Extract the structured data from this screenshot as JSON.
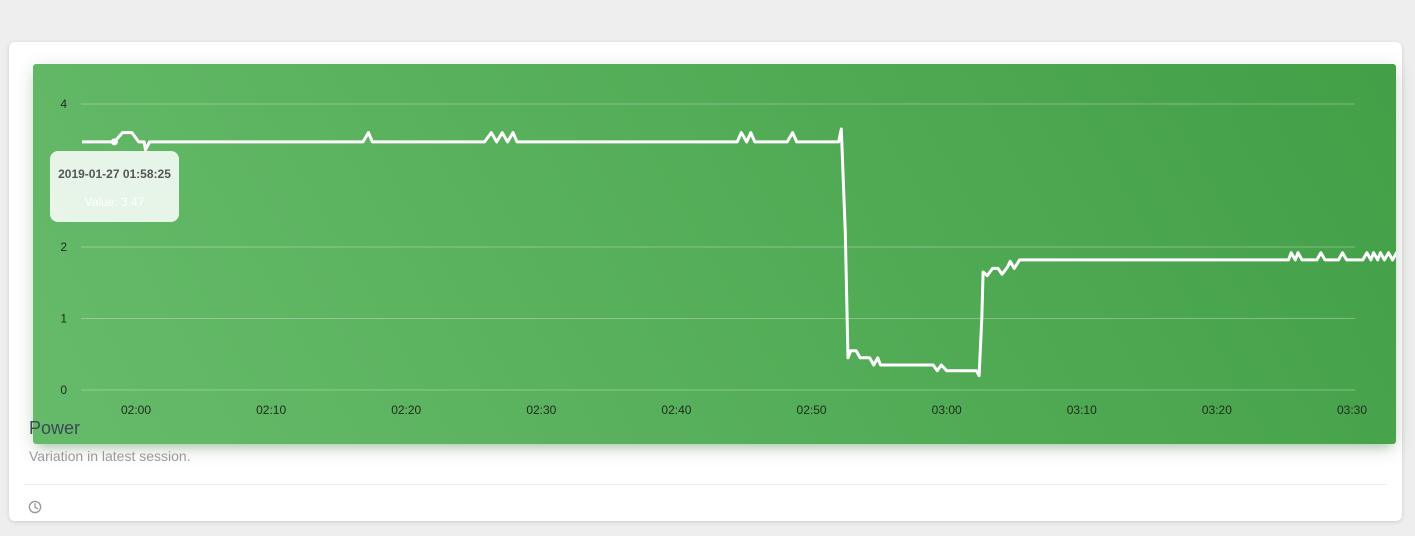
{
  "card": {
    "title": "Power",
    "category": "Variation in latest session.",
    "footer_text": ""
  },
  "colors": {
    "header_gradient_start": "#66bb6a",
    "header_gradient_end": "#43a047",
    "line": "#ffffff",
    "grid": "rgba(255,255,255,0.3)"
  },
  "tooltip": {
    "date": "2019-01-27 01:58:25",
    "value": "Value: 3.47"
  },
  "chart_data": {
    "type": "line",
    "ylim": [
      0,
      4
    ],
    "y_ticks": [
      0,
      1,
      2,
      4
    ],
    "x_ticks": [
      "02:00",
      "02:10",
      "02:20",
      "02:30",
      "02:40",
      "02:50",
      "03:00",
      "03:10",
      "03:20",
      "03:30"
    ],
    "x_range_minutes": [
      116,
      210.2
    ],
    "grid": true,
    "series": [
      {
        "name": "",
        "points": [
          [
            116.0,
            3.47
          ],
          [
            118.0,
            3.47
          ],
          [
            118.4,
            3.47
          ],
          [
            119.0,
            3.6
          ],
          [
            119.7,
            3.6
          ],
          [
            120.2,
            3.47
          ],
          [
            120.6,
            3.47
          ],
          [
            120.7,
            3.36
          ],
          [
            121.0,
            3.47
          ],
          [
            136.8,
            3.47
          ],
          [
            137.2,
            3.6
          ],
          [
            137.5,
            3.47
          ],
          [
            145.8,
            3.47
          ],
          [
            146.3,
            3.6
          ],
          [
            146.7,
            3.47
          ],
          [
            147.1,
            3.6
          ],
          [
            147.5,
            3.47
          ],
          [
            147.9,
            3.6
          ],
          [
            148.2,
            3.47
          ],
          [
            164.5,
            3.47
          ],
          [
            164.8,
            3.6
          ],
          [
            165.2,
            3.47
          ],
          [
            165.5,
            3.6
          ],
          [
            165.8,
            3.47
          ],
          [
            168.2,
            3.47
          ],
          [
            168.6,
            3.6
          ],
          [
            168.9,
            3.47
          ],
          [
            172.0,
            3.47
          ],
          [
            172.2,
            3.65
          ],
          [
            172.5,
            2.2
          ],
          [
            172.7,
            0.45
          ],
          [
            172.9,
            0.55
          ],
          [
            173.3,
            0.55
          ],
          [
            173.6,
            0.45
          ],
          [
            174.3,
            0.45
          ],
          [
            174.6,
            0.35
          ],
          [
            174.9,
            0.45
          ],
          [
            175.1,
            0.35
          ],
          [
            179.0,
            0.35
          ],
          [
            179.3,
            0.27
          ],
          [
            179.6,
            0.35
          ],
          [
            180.0,
            0.27
          ],
          [
            182.2,
            0.27
          ],
          [
            182.4,
            0.2
          ],
          [
            182.6,
            1.0
          ],
          [
            182.7,
            1.65
          ],
          [
            183.0,
            1.6
          ],
          [
            183.4,
            1.7
          ],
          [
            183.8,
            1.7
          ],
          [
            184.1,
            1.62
          ],
          [
            184.5,
            1.72
          ],
          [
            184.7,
            1.8
          ],
          [
            185.0,
            1.7
          ],
          [
            185.4,
            1.82
          ],
          [
            205.3,
            1.82
          ],
          [
            205.5,
            1.92
          ],
          [
            205.8,
            1.82
          ],
          [
            206.0,
            1.92
          ],
          [
            206.3,
            1.82
          ],
          [
            207.4,
            1.82
          ],
          [
            207.7,
            1.92
          ],
          [
            208.0,
            1.82
          ],
          [
            209.0,
            1.82
          ],
          [
            209.3,
            1.92
          ],
          [
            209.6,
            1.82
          ],
          [
            210.8,
            1.82
          ],
          [
            211.1,
            1.92
          ],
          [
            211.4,
            1.82
          ],
          [
            211.6,
            1.92
          ],
          [
            211.9,
            1.82
          ],
          [
            212.1,
            1.92
          ],
          [
            212.4,
            1.82
          ],
          [
            212.7,
            1.92
          ],
          [
            213.0,
            1.82
          ],
          [
            213.3,
            1.92
          ],
          [
            213.6,
            1.82
          ],
          [
            214.2,
            1.82
          ],
          [
            214.5,
            1.9
          ],
          [
            215.6,
            1.9
          ]
        ]
      }
    ]
  }
}
